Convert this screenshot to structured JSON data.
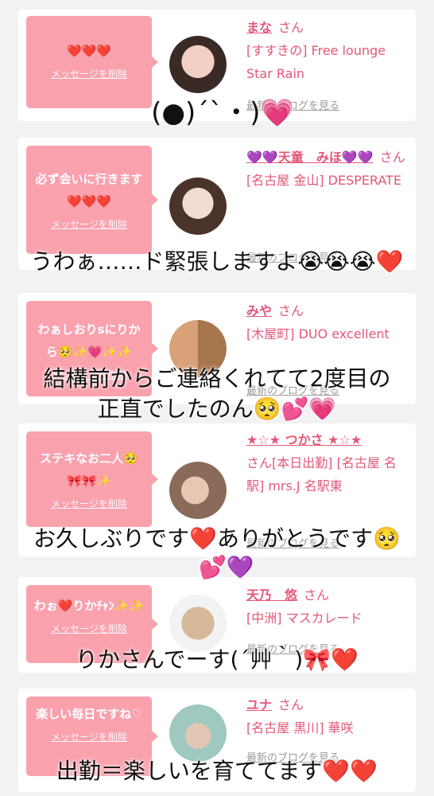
{
  "cards": [
    {
      "message": "❤️❤️❤️",
      "delete_label": "メッセージを削除",
      "name": "まな",
      "san": "さん",
      "shop": "[すすきの] Free lounge Star Rain",
      "blog_label": "最新のブログを見る"
    },
    {
      "message": "必ず会いに行きます❤️❤️❤️",
      "delete_label": "メッセージを削除",
      "name": "💜💜天童　みほ💜💜",
      "san": "さん",
      "shop": "[名古屋 金山] DESPERATE",
      "blog_label": "最新のブログを見る"
    },
    {
      "message": "わぁしおりsにりから🥺✨💗✨✨",
      "delete_label": "メッセージを削除",
      "name": "みや",
      "san": "さん",
      "shop": "[木屋町] DUO excellent",
      "blog_label": "最新のブログを見る"
    },
    {
      "message": "ステキなお二人🥺🎀🎀✨",
      "delete_label": "メッセージを削除",
      "name": "★☆★ つかさ ★☆★",
      "san": "さん",
      "shop": "[本日出勤] [名古屋 名駅] mrs.J 名駅東",
      "blog_label": "最新のブログを見る"
    },
    {
      "message": "わぉ❤️りかﾁｬﾝ✨✨",
      "delete_label": "メッセージを削除",
      "name": "天乃　悠",
      "san": "さん",
      "shop": "[中洲] マスカレード",
      "blog_label": "最新のブログを見る"
    },
    {
      "message": "楽しい毎日ですね♡",
      "delete_label": "メッセージを削除",
      "name": "ユナ",
      "san": "さん",
      "shop": "[名古屋 黒川] 華咲",
      "blog_label": "最新のブログを見る"
    }
  ],
  "overlays": [
    "(●)´`・)💗",
    "うわぁ……ド緊張しますよ😭😭😭❤️",
    "結構前からご連絡くれてて2度目の",
    "正直でしたのん🥺💕💗",
    "お久しぶりです❤️ありがとうです🥺",
    "💕💜",
    "りかさんでーす(´艸｀)🎀❤️",
    "出勤＝楽しいを育ててます❤️❤️"
  ],
  "colors": {
    "background": "#f2f2f2",
    "bubble": "#f9a1ad",
    "name_text": "#e3577a",
    "link_gray": "#9a9a9a"
  }
}
